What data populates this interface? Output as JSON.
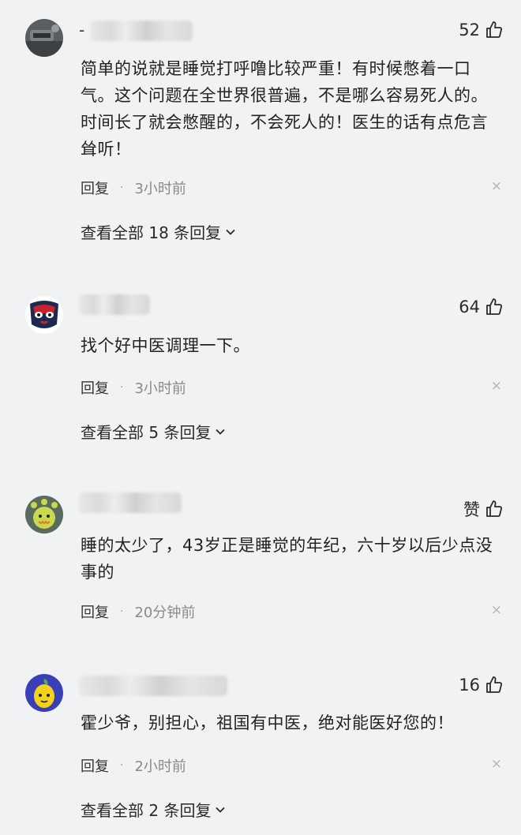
{
  "comments": [
    {
      "username_prefix": "-",
      "likes": "52",
      "text": "简单的说就是睡觉打呼噜比较严重！有时候憋着一口气。这个问题在全世界很普遍，不是哪么容易死人的。时间长了就会憋醒的，不会死人的！医生的话有点危言耸听！",
      "reply_label": "回复",
      "time": "3小时前",
      "close": "×",
      "view_all": "查看全部 18 条回复"
    },
    {
      "username_prefix": "",
      "likes": "64",
      "text": "找个好中医调理一下。",
      "reply_label": "回复",
      "time": "3小时前",
      "close": "×",
      "view_all": "查看全部 5 条回复"
    },
    {
      "username_prefix": "",
      "likes": "赞",
      "text": "睡的太少了，43岁正是睡觉的年纪，六十岁以后少点没事的",
      "reply_label": "回复",
      "time": "20分钟前",
      "close": "×"
    },
    {
      "username_prefix": "",
      "likes": "16",
      "text": "霍少爷，别担心，祖国有中医，绝对能医好您的！",
      "reply_label": "回复",
      "time": "2小时前",
      "close": "×",
      "view_all": "查看全部 2 条回复"
    }
  ],
  "icons": {
    "like": "thumbs-up-icon",
    "expand": "chevron-down-icon",
    "close": "close-icon"
  },
  "colors": {
    "background": "#f1f2f3",
    "text": "#222222",
    "muted": "#8a8a8a"
  }
}
